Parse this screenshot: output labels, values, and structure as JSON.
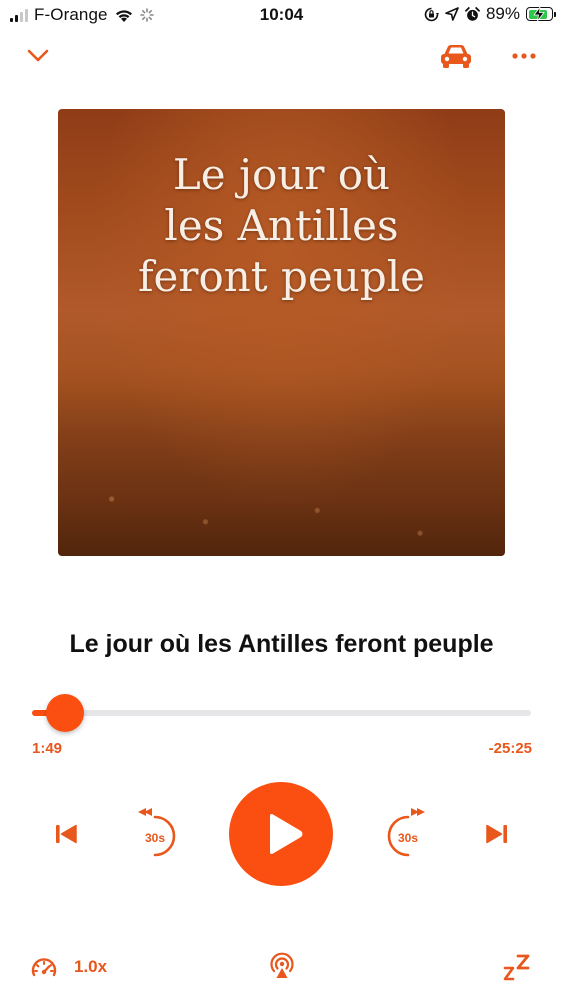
{
  "status_bar": {
    "carrier": "F-Orange",
    "time": "10:04",
    "battery_percent": "89%",
    "battery_level": 0.89,
    "icons": [
      "signal-icon",
      "wifi-icon",
      "activity-icon",
      "rotation-lock-icon",
      "location-icon",
      "alarm-icon",
      "battery-charging-icon"
    ]
  },
  "nav": {
    "icons": [
      "chevron-down-icon",
      "car-icon",
      "more-icon"
    ]
  },
  "artwork": {
    "title": "Le jour où\nles Antilles\nferont peuple"
  },
  "track": {
    "title": "Le jour où les Antilles feront peuple"
  },
  "progress": {
    "elapsed": "1:49",
    "remaining": "-25:25",
    "played_fraction": 0.067
  },
  "controls": {
    "rewind_label": "30s",
    "forward_label": "30s",
    "icons": [
      "previous-chapter-icon",
      "rewind-30-icon",
      "play-icon",
      "forward-30-icon",
      "next-chapter-icon"
    ]
  },
  "bottom": {
    "speed": "1.0x",
    "icons": [
      "speedometer-icon",
      "airplay-icon",
      "sleep-timer-icon"
    ]
  },
  "colors": {
    "accent": "#fb4f12",
    "accent_text": "#e8571c",
    "track_bg": "#e6e6e9",
    "battery_fill": "#2fc64a"
  }
}
